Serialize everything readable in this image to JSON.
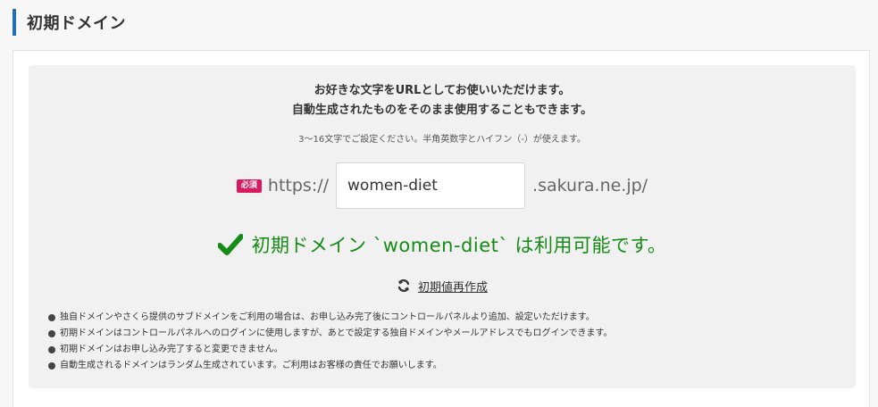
{
  "header": {
    "title": "初期ドメイン"
  },
  "intro": {
    "line1": "お好きな文字をURLとしてお使いいただけます。",
    "line2": "自動生成されたものをそのまま使用することもできます。"
  },
  "hint": "3〜16文字でご設定ください。半角英数字とハイフン（-）が使えます。",
  "form": {
    "required_badge": "必須",
    "prefix": "https://",
    "domain_value": "women-diet",
    "suffix": ".sakura.ne.jp/"
  },
  "status": {
    "message": "初期ドメイン `women-diet` は利用可能です。",
    "color": "#168b16",
    "icon": "check-icon"
  },
  "actions": {
    "regenerate_label": "初期値再作成",
    "icon": "refresh-icon"
  },
  "notes": [
    "独自ドメインやさくら提供のサブドメインをご利用の場合は、お申し込み完了後にコントロールパネルより追加、設定いただけます。",
    "初期ドメインはコントロールパネルへのログインに使用しますが、あとで設定する独自ドメインやメールアドレスでもログインできます。",
    "初期ドメインはお申し込み完了すると変更できません。",
    "自動生成されるドメインはランダム生成されています。ご利用はお客様の責任でお願いします。"
  ],
  "colors": {
    "accent": "#1f6fb2",
    "required": "#d81b60",
    "success": "#168b16"
  }
}
